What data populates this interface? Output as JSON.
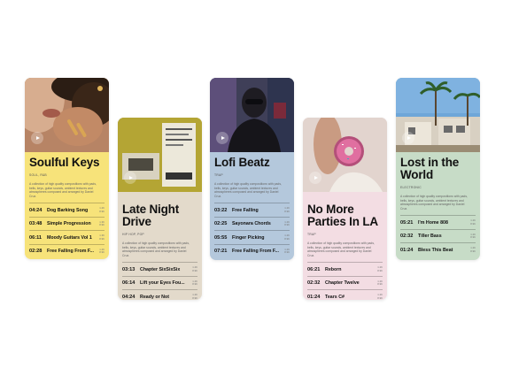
{
  "colors": {
    "yellow": "#f7e37a",
    "beige": "#e3dacb",
    "blue": "#b4c8dc",
    "pink": "#f3dde3",
    "green": "#c7dcc7"
  },
  "cards": [
    {
      "title": "Soulful Keys",
      "genre": "SOUL, R&B",
      "description": "A collection of high quality compositions with pads, bells, keys, guitar sounds, ambient textures and atmospheres composed and arranged by Daniel Cruz.",
      "tracks": [
        {
          "duration": "04:24",
          "name": "Dog Barking Song",
          "meta1": "1.2K",
          "meta2": "8.9K"
        },
        {
          "duration": "03:48",
          "name": "Simple Progression",
          "meta1": "1.3K",
          "meta2": "8.9K"
        },
        {
          "duration": "06:11",
          "name": "Moody Guitars Vol 1",
          "meta1": "1.3K",
          "meta2": "8.9K"
        },
        {
          "duration": "02:28",
          "name": "Free Falling From F...",
          "meta1": "1.2K",
          "meta2": "8.9K"
        }
      ]
    },
    {
      "title": "Late Night Drive",
      "genre": "HIP HOP, POP",
      "description": "A collection of high quality compositions with pads, bells, keys, guitar sounds, ambient textures and atmospheres composed and arranged by Daniel Cruz.",
      "tracks": [
        {
          "duration": "03:13",
          "name": "Chapter SixSixSix",
          "meta1": "1.2K",
          "meta2": "8.9K"
        },
        {
          "duration": "06:14",
          "name": "Lift your Eyes Fou...",
          "meta1": "1.2K",
          "meta2": "8.9K"
        },
        {
          "duration": "04:24",
          "name": "Ready or Not",
          "meta1": "1.2K",
          "meta2": "8.9K"
        }
      ]
    },
    {
      "title": "Lofi Beatz",
      "genre": "TRAP",
      "description": "A collection of high quality compositions with pads, bells, keys, guitar sounds, ambient textures and atmospheres composed and arranged by Daniel Cruz.",
      "tracks": [
        {
          "duration": "03:22",
          "name": "Free Falling",
          "meta1": "1.2K",
          "meta2": "8.9K"
        },
        {
          "duration": "02:25",
          "name": "Sayonara Chords",
          "meta1": "1.2K",
          "meta2": "8.9K"
        },
        {
          "duration": "05:55",
          "name": "Finger Picking",
          "meta1": "1.2K",
          "meta2": "8.9K"
        },
        {
          "duration": "07:21",
          "name": "Free Falling From F...",
          "meta1": "1.2K",
          "meta2": "8.9K"
        }
      ]
    },
    {
      "title": "No More Parties In LA",
      "genre": "TRAP",
      "description": "A collection of high quality compositions with pads, bells, keys, guitar sounds, ambient textures and atmospheres composed and arranged by Daniel Cruz.",
      "tracks": [
        {
          "duration": "06:21",
          "name": "Reborn",
          "meta1": "1.2K",
          "meta2": "8.9K"
        },
        {
          "duration": "02:32",
          "name": "Chapter Twelve",
          "meta1": "1.2K",
          "meta2": "8.9K"
        },
        {
          "duration": "01:24",
          "name": "Tears C#",
          "meta1": "1.2K",
          "meta2": "8.9K"
        }
      ]
    },
    {
      "title": "Lost in the World",
      "genre": "ELECTRONIC",
      "description": "A collection of high quality compositions with pads, bells, keys, guitar sounds, ambient textures and atmospheres composed and arranged by Daniel Cruz.",
      "tracks": [
        {
          "duration": "05:21",
          "name": "I'm Home 808",
          "meta1": "1.2K",
          "meta2": "8.9K"
        },
        {
          "duration": "02:32",
          "name": "Tiller Bass",
          "meta1": "1.2K",
          "meta2": "8.9K"
        },
        {
          "duration": "01:24",
          "name": "Bless This Beat",
          "meta1": "1.2K",
          "meta2": "8.9K"
        }
      ]
    }
  ]
}
